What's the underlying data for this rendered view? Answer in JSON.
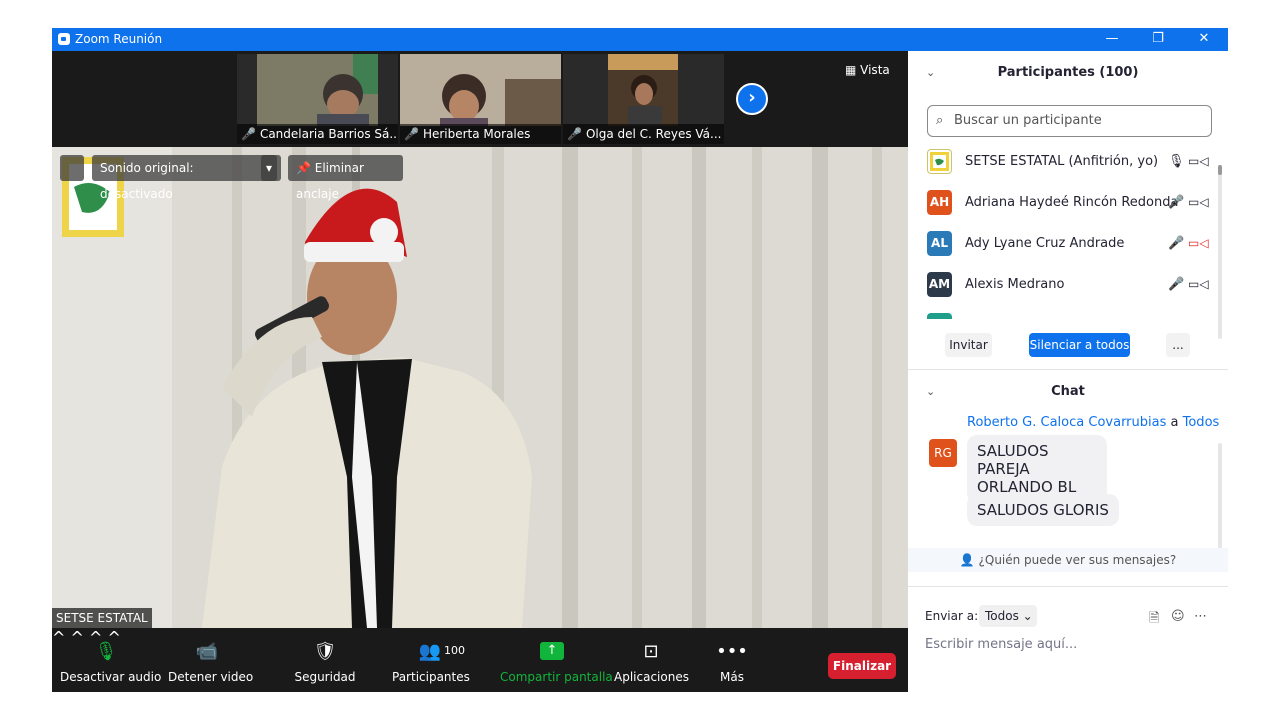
{
  "window": {
    "title": "Zoom Reunión",
    "minimize": "—",
    "restore": "❐",
    "close": "✕"
  },
  "gallery": {
    "thumbnails": [
      {
        "name": "Candelaria Barrios Sá..."
      },
      {
        "name": "Heriberta Morales"
      },
      {
        "name": "Olga del C. Reyes Vá..."
      }
    ],
    "next_icon": "›",
    "view_label": "Vista"
  },
  "video": {
    "audio_toggle": "Sonido original: desactivado",
    "unpin": "Eliminar anclaje",
    "speaker_tag": "SETSE ESTATAL"
  },
  "toolbar": {
    "audio": "Desactivar audio",
    "video": "Detener video",
    "security": "Seguridad",
    "participants": "Participantes",
    "participants_count": "100",
    "share": "Compartir pantalla",
    "apps": "Aplicaciones",
    "more": "Más",
    "end": "Finalizar"
  },
  "participants_panel": {
    "title": "Participantes (100)",
    "search_placeholder": "Buscar un participante",
    "list": [
      {
        "initials": "",
        "name": "SETSE ESTATAL (Anfitrión, yo)",
        "avatar_color": "#ffffff",
        "mic_muted": false,
        "cam_off": false
      },
      {
        "initials": "AH",
        "name": "Adriana Haydeé Rincón Redonda",
        "avatar_color": "#e0521b",
        "mic_muted": true,
        "cam_off": false
      },
      {
        "initials": "AL",
        "name": "Ady Lyane Cruz Andrade",
        "avatar_color": "#2a7ab8",
        "mic_muted": true,
        "cam_off": true
      },
      {
        "initials": "AM",
        "name": "Alexis Medrano",
        "avatar_color": "#2d3a4a",
        "mic_muted": true,
        "cam_off": false
      }
    ],
    "invite": "Invitar",
    "mute_all": "Silenciar a todos",
    "more": "..."
  },
  "chat": {
    "title": "Chat",
    "sender": "Roberto G. Caloca Covarrubias",
    "to_word": "a",
    "recipient": "Todos",
    "avatar": "RG",
    "messages": [
      "SALUDOS PAREJA ORLANDO BL",
      "SALUDOS GLORIS"
    ],
    "visibility": "¿Quién puede ver sus mensajes?",
    "send_to_label": "Enviar a:",
    "send_to_value": "Todos",
    "input_placeholder": "Escribir mensaje aquí..."
  },
  "colors": {
    "zoom_blue": "#0e72ed",
    "end_red": "#d6202f",
    "share_green": "#12b53b",
    "mute_red": "#e02828"
  }
}
